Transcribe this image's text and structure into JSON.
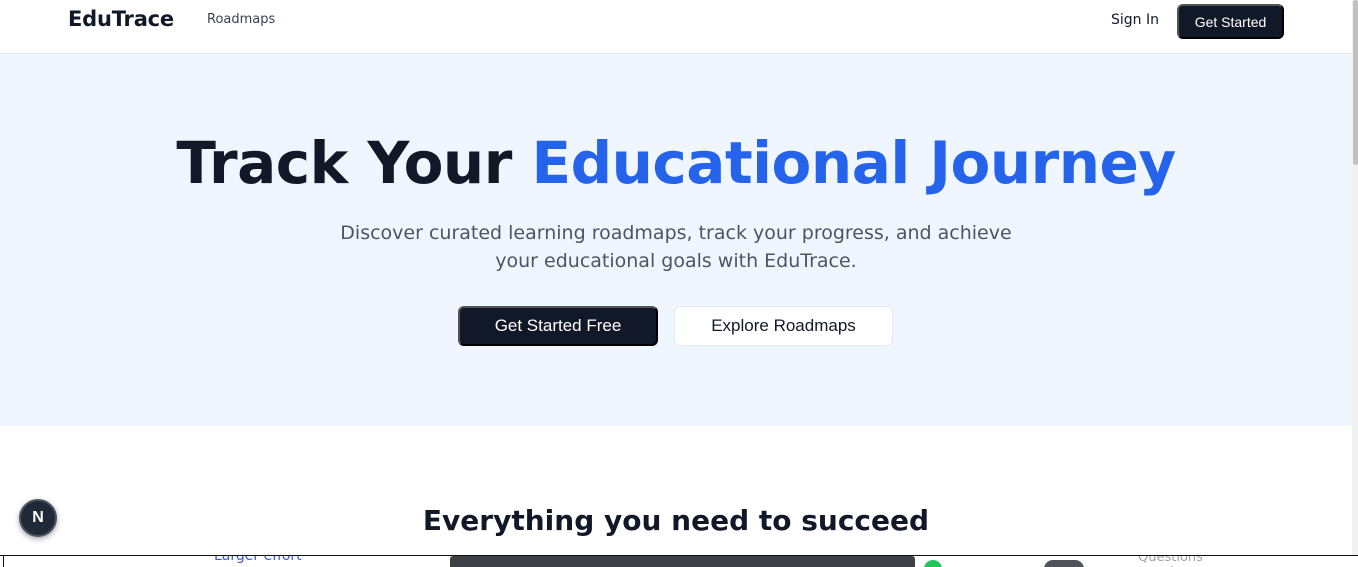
{
  "nav": {
    "brand": "EduTrace",
    "links": [
      "Roadmaps"
    ],
    "signin_label": "Sign In",
    "cta_label": "Get Started"
  },
  "hero": {
    "title_part1": "Track Your ",
    "title_highlight": "Educational Journey",
    "subtitle": "Discover curated learning roadmaps, track your progress, and achieve your educational goals with EduTrace.",
    "primary_button": "Get Started Free",
    "secondary_button": "Explore Roadmaps"
  },
  "features": {
    "title": "Everything you need to succeed"
  },
  "devtools": {
    "badge_letter": "N"
  },
  "underlay": {
    "link_text": "Larger effort",
    "bar_text": "Questions to ask"
  },
  "colors": {
    "accent": "#2563eb",
    "dark": "#111827",
    "hero_bg": "#eff6ff"
  }
}
